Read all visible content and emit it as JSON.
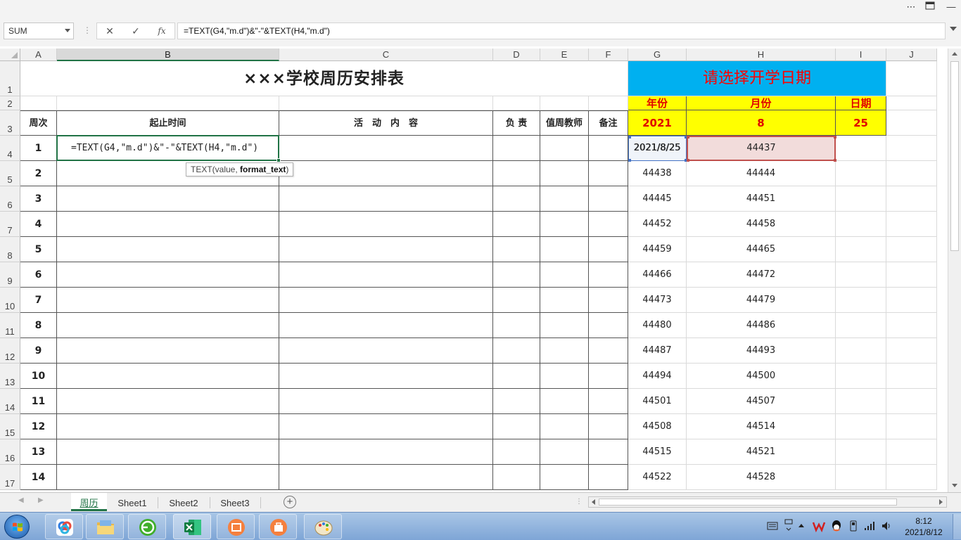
{
  "formula_bar": {
    "name_box": "SUM",
    "cancel_glyph": "✕",
    "enter_glyph": "✓",
    "fx_glyph": "fx",
    "formula": "=TEXT(G4,\"m.d\")&\"-\"&TEXT(H4,\"m.d\")"
  },
  "columns": [
    {
      "label": "A"
    },
    {
      "label": "B"
    },
    {
      "label": "C"
    },
    {
      "label": "D"
    },
    {
      "label": "E"
    },
    {
      "label": "F"
    },
    {
      "label": "G"
    },
    {
      "label": "H"
    },
    {
      "label": "I"
    },
    {
      "label": "J"
    }
  ],
  "rows": [
    "1",
    "2",
    "3",
    "4",
    "5",
    "6",
    "7",
    "8",
    "9",
    "10",
    "11",
    "12",
    "13",
    "14",
    "15",
    "16",
    "17"
  ],
  "sheet": {
    "title": "×××学校周历安排表",
    "prompt_banner": "请选择开学日期",
    "headers": {
      "week": "周次",
      "date_range": "起止时间",
      "activity": "活　动　内　容",
      "owner": "负 责",
      "duty_teacher": "值周教师",
      "remark": "备注"
    },
    "date_picker": {
      "year_label": "年份",
      "month_label": "月份",
      "day_label": "日期",
      "year": "2021",
      "month": "8",
      "day": "25"
    },
    "editing_formula": "=TEXT(G4,\"m.d\")&\"-\"&TEXT(H4,\"m.d\")",
    "tooltip_prefix": "TEXT(value, ",
    "tooltip_bold": "format_text",
    "tooltip_suffix": ")",
    "weeks": [
      {
        "week": "1",
        "start": "2021/8/25",
        "end": "44437"
      },
      {
        "week": "2",
        "start": "44438",
        "end": "44444"
      },
      {
        "week": "3",
        "start": "44445",
        "end": "44451"
      },
      {
        "week": "4",
        "start": "44452",
        "end": "44458"
      },
      {
        "week": "5",
        "start": "44459",
        "end": "44465"
      },
      {
        "week": "6",
        "start": "44466",
        "end": "44472"
      },
      {
        "week": "7",
        "start": "44473",
        "end": "44479"
      },
      {
        "week": "8",
        "start": "44480",
        "end": "44486"
      },
      {
        "week": "9",
        "start": "44487",
        "end": "44493"
      },
      {
        "week": "10",
        "start": "44494",
        "end": "44500"
      },
      {
        "week": "11",
        "start": "44501",
        "end": "44507"
      },
      {
        "week": "12",
        "start": "44508",
        "end": "44514"
      },
      {
        "week": "13",
        "start": "44515",
        "end": "44521"
      },
      {
        "week": "14",
        "start": "44522",
        "end": "44528"
      }
    ]
  },
  "tabs": {
    "active": "周历",
    "others": [
      "Sheet1",
      "Sheet2",
      "Sheet3"
    ],
    "add": "+"
  },
  "taskbar": {
    "time": "8:12",
    "date": "2021/8/12"
  },
  "colors": {
    "excel_green": "#217346",
    "banner_blue": "#00b0f0",
    "highlight_yellow": "#ffff00",
    "banner_text_red": "#ff0000"
  }
}
